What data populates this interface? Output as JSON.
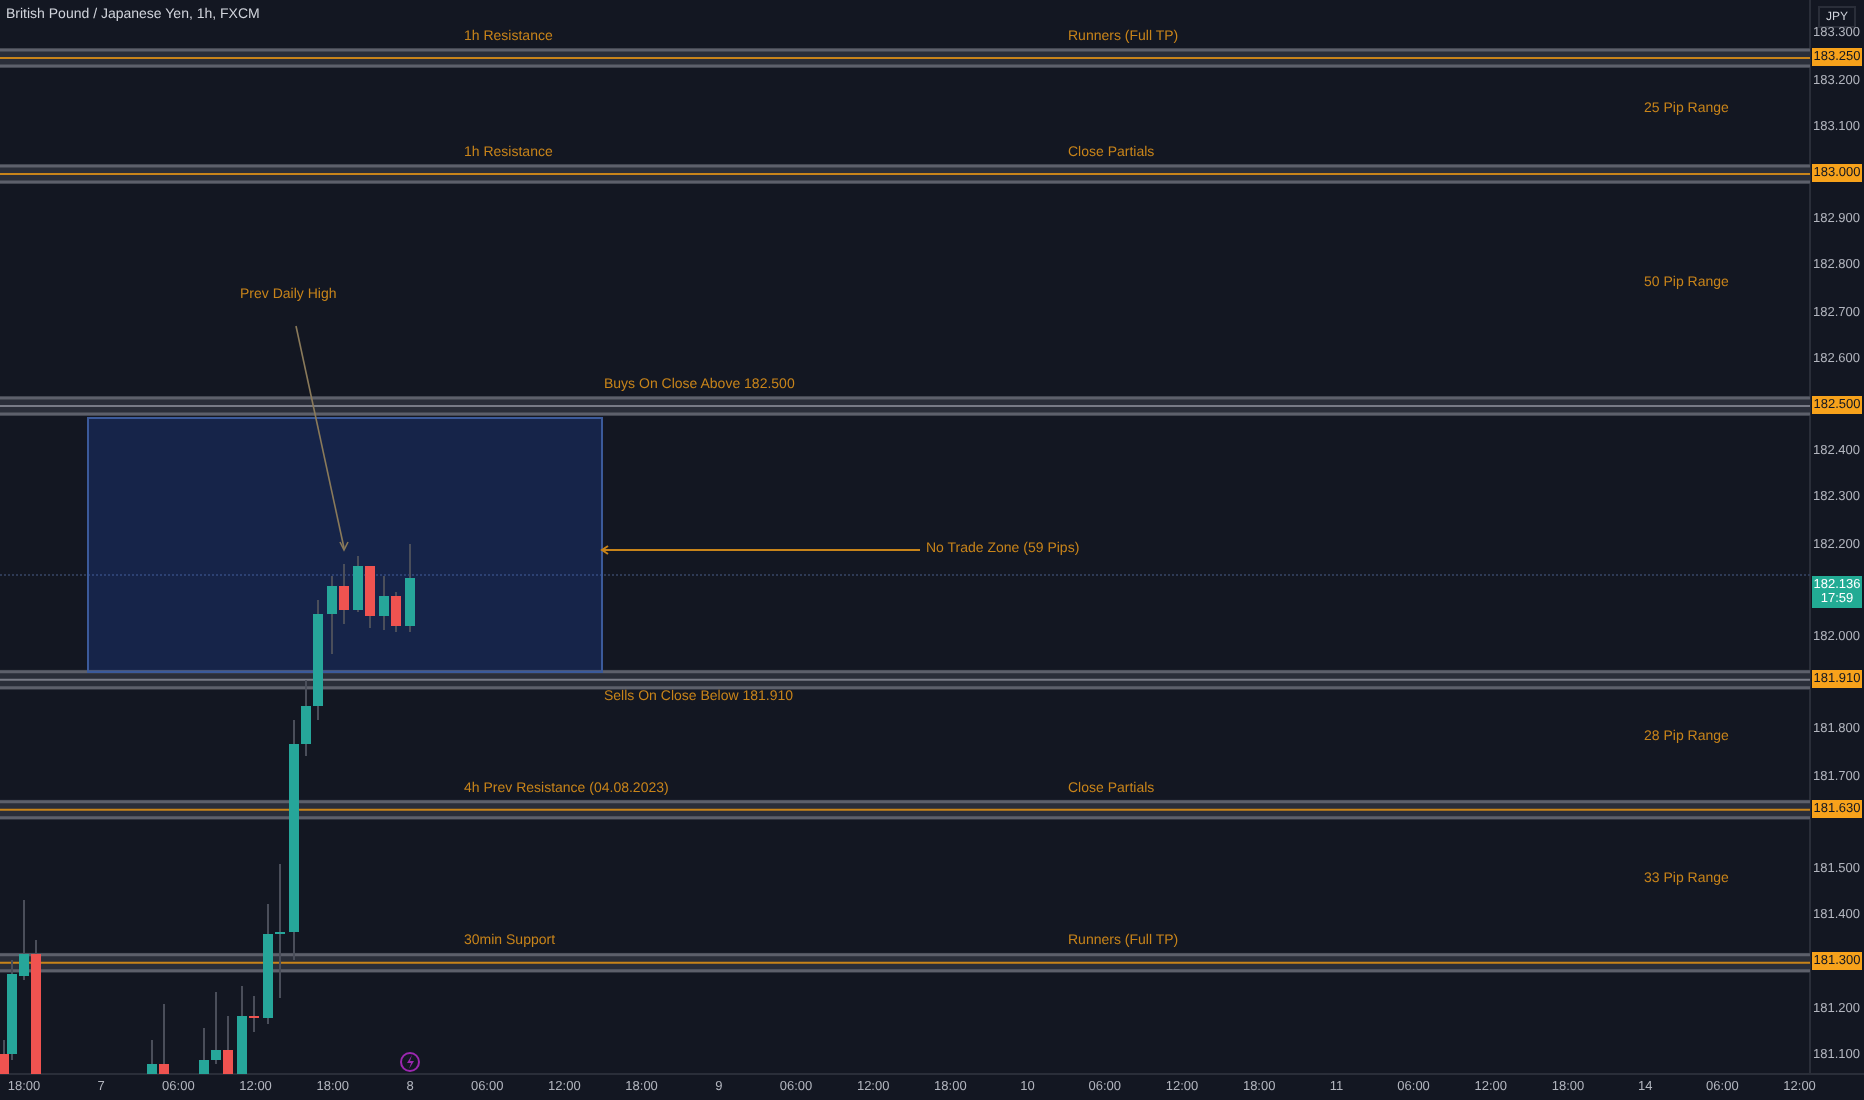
{
  "title": "British Pound / Japanese Yen, 1h, FXCM",
  "currency": "JPY",
  "price_axis": [
    "183.300",
    "183.200",
    "183.100",
    "182.900",
    "182.800",
    "182.700",
    "182.600",
    "182.400",
    "182.300",
    "182.200",
    "182.000",
    "181.800",
    "181.700",
    "181.500",
    "181.400",
    "181.200",
    "181.100"
  ],
  "levels": [
    {
      "price_tag": "183.250",
      "center_line": true,
      "range_label": "25 Pip Range",
      "labels": [
        {
          "kind": "left",
          "text": "1h Resistance"
        },
        {
          "kind": "right",
          "text": "Runners (Full TP)"
        }
      ]
    },
    {
      "price_tag": "183.000",
      "center_line": true,
      "range_label": "50 Pip Range",
      "labels": [
        {
          "kind": "left",
          "text": "1h Resistance"
        },
        {
          "kind": "right",
          "text": "Close Partials"
        }
      ]
    },
    {
      "price_tag": "182.500",
      "center_line": false,
      "labels": [
        {
          "kind": "above",
          "text": "Buys On Close Above 182.500"
        }
      ]
    },
    {
      "price_tag": "181.910",
      "center_line": false,
      "range_label": "28 Pip Range",
      "labels": [
        {
          "kind": "below",
          "text": "Sells On Close Below 181.910"
        }
      ]
    },
    {
      "price_tag": "181.630",
      "center_line": true,
      "range_label": "33 Pip Range",
      "labels": [
        {
          "kind": "left",
          "text": "4h Prev Resistance (04.08.2023)"
        },
        {
          "kind": "right",
          "text": "Close Partials"
        }
      ]
    },
    {
      "price_tag": "181.300",
      "center_line": true,
      "labels": [
        {
          "kind": "left",
          "text": "30min Support"
        },
        {
          "kind": "right",
          "text": "Runners (Full TP)"
        }
      ]
    }
  ],
  "no_trade_zone": {
    "label": "No Trade Zone (59 Pips)"
  },
  "prev_daily_high": {
    "label": "Prev Daily High"
  },
  "current_price": {
    "price": "182.136",
    "countdown": "17:59"
  },
  "time_axis": [
    "18:00",
    "7",
    "06:00",
    "12:00",
    "18:00",
    "8",
    "06:00",
    "12:00",
    "18:00",
    "9",
    "06:00",
    "12:00",
    "18:00",
    "10",
    "06:00",
    "12:00",
    "18:00",
    "11",
    "06:00",
    "12:00",
    "18:00",
    "14",
    "06:00",
    "12:00"
  ]
}
